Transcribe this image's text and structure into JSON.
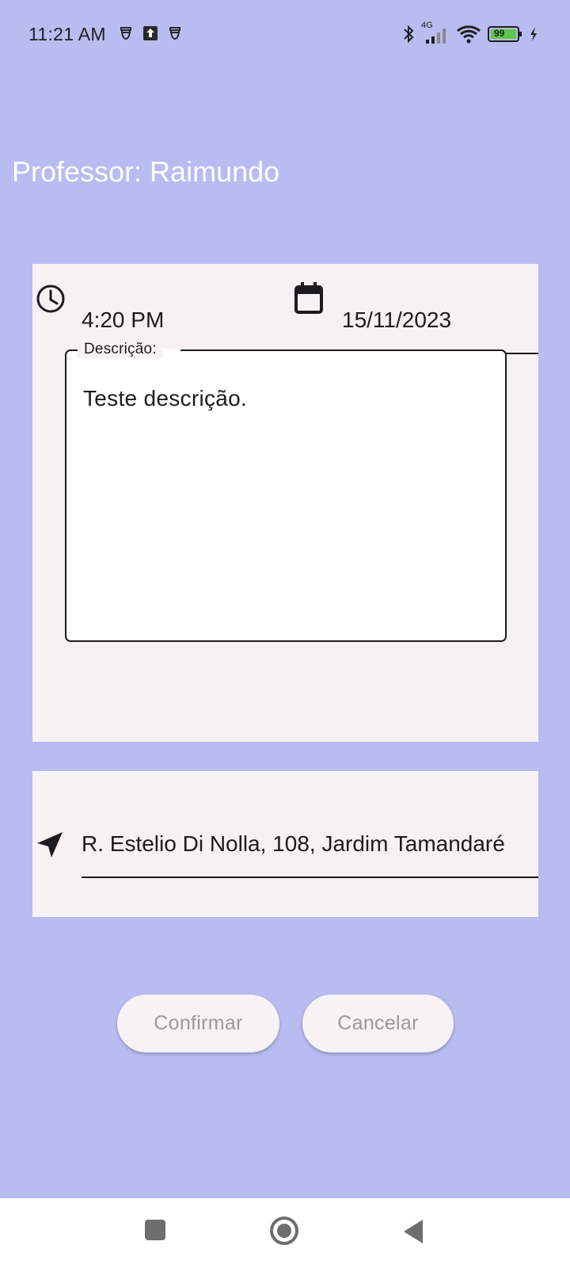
{
  "status_bar": {
    "time": "11:21 AM",
    "network_label": "4G",
    "battery_level": "99"
  },
  "header": {
    "title": "Professor: Raimundo"
  },
  "form": {
    "time_value": "4:20 PM",
    "date_value": "15/11/2023",
    "description_label": "Descrição:",
    "description_value": "Teste descrição.",
    "location_value": "R. Estelio Di Nolla, 108, Jardim Tamandaré"
  },
  "actions": {
    "confirm_label": "Confirmar",
    "cancel_label": "Cancelar"
  },
  "icons": {
    "time": "clock-icon",
    "date": "calendar-icon",
    "location": "navigation-arrow-icon"
  },
  "colors": {
    "background": "#b8bcf1",
    "card": "#f6f1f2",
    "button_text": "#9a9a9a"
  }
}
